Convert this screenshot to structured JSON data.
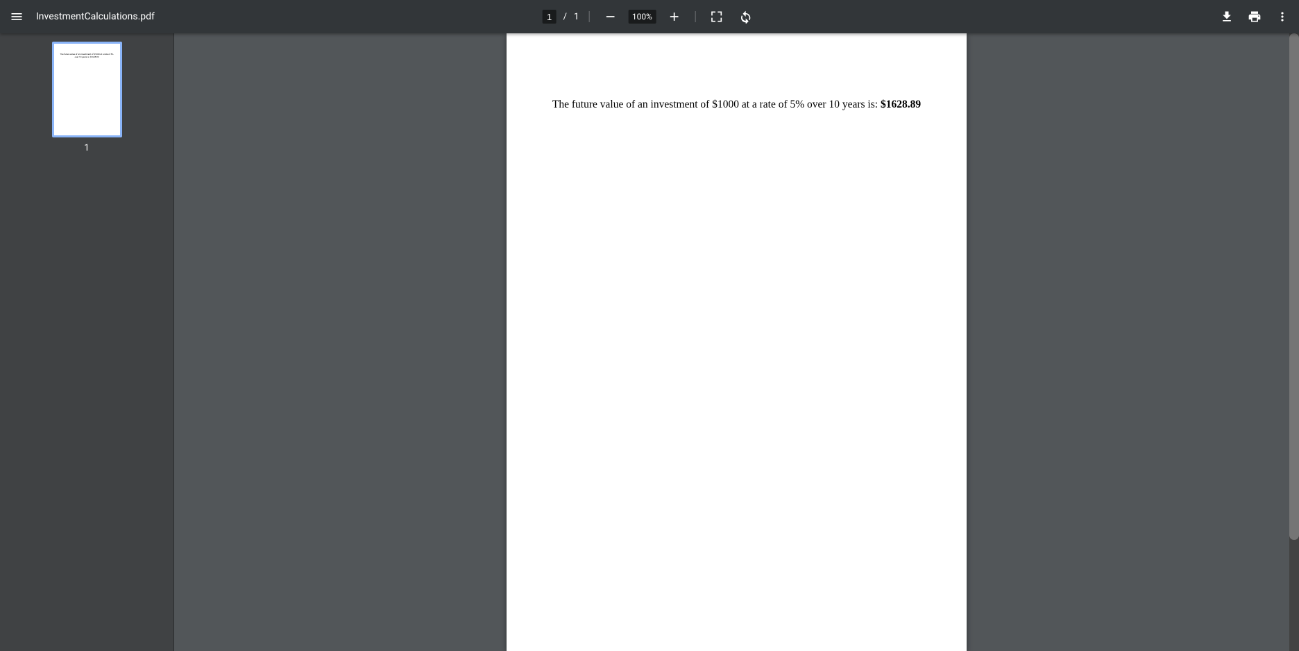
{
  "toolbar": {
    "filename": "InvestmentCalculations.pdf",
    "page_current": "1",
    "page_separator": "/",
    "page_total": "1",
    "zoom_level": "100%"
  },
  "sidebar": {
    "thumbnails": [
      {
        "label": "1",
        "preview_text": "The future value of an investment of $1000 at a rate of 5% over 10 years is: $1628.89"
      }
    ]
  },
  "document": {
    "content_text": "The future value of an investment of $1000 at a rate of 5% over 10 years is: ",
    "content_value": "$1628.89"
  }
}
